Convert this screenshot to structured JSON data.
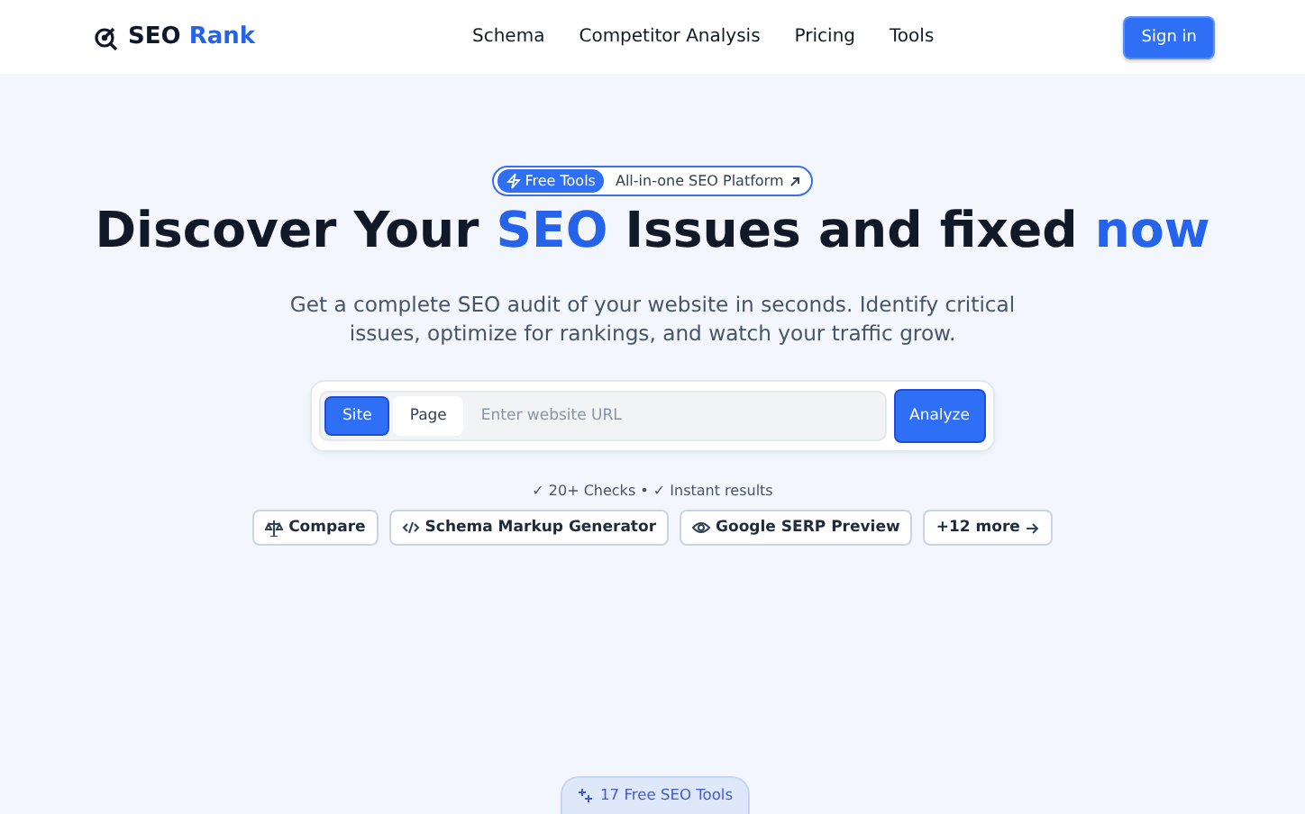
{
  "nav": {
    "brand": [
      {
        "text": "SEO",
        "highlight": false
      },
      {
        "text": "Rank",
        "highlight": true
      }
    ],
    "links": [
      "Schema",
      "Competitor Analysis",
      "Pricing",
      "Tools"
    ],
    "sign_in": "Sign in"
  },
  "hero": {
    "badge": {
      "tag": "Free Tools",
      "text": "All-in-one SEO Platform"
    },
    "title": [
      {
        "text": "Discover Your ",
        "highlight": false
      },
      {
        "text": "SEO",
        "highlight": true
      },
      {
        "text": " Issues and fixed ",
        "highlight": false
      },
      {
        "text": "now",
        "highlight": true
      }
    ],
    "subtitle": "Get a complete SEO audit of your website in seconds. Identify critical issues, optimize for rankings, and watch your traffic grow.",
    "search": {
      "modes": [
        {
          "label": "Site",
          "selected": true
        },
        {
          "label": "Page",
          "selected": false
        }
      ],
      "placeholder": "Enter website URL",
      "button": "Analyze"
    },
    "checks": "✓ 20+ Checks • ✓ Instant results",
    "tools": [
      {
        "kind": "scale",
        "label": "Compare"
      },
      {
        "kind": "code",
        "label": "Schema Markup Generator"
      },
      {
        "kind": "eye",
        "label": "Google SERP Preview"
      },
      {
        "kind": "more",
        "label": "+12 more"
      }
    ]
  },
  "footer_badge": "17 Free SEO Tools"
}
